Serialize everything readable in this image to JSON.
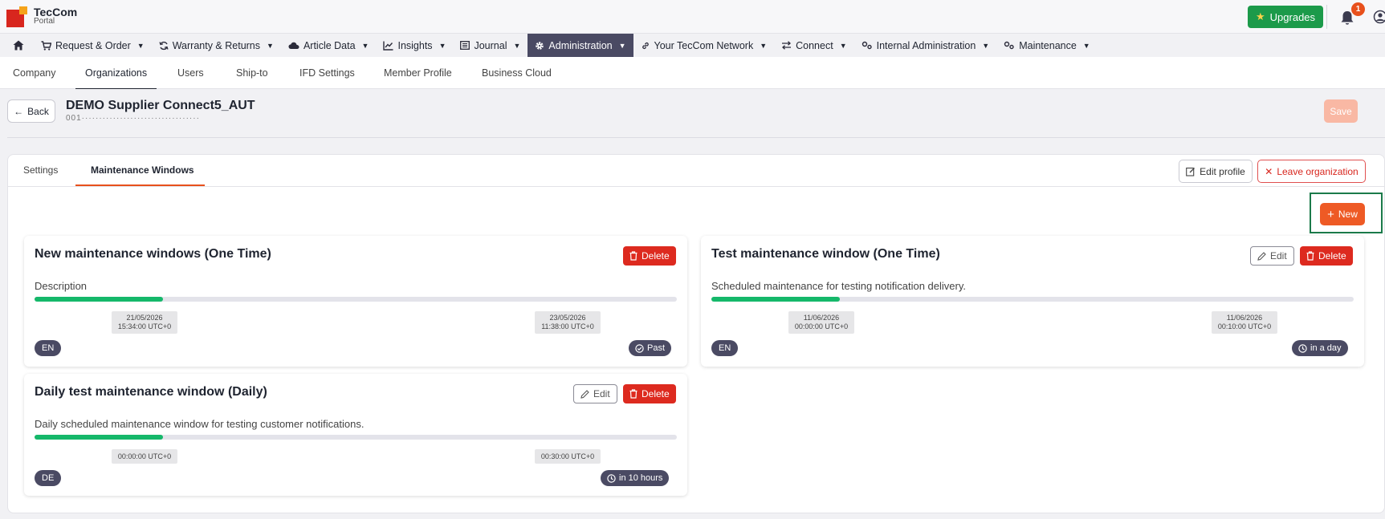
{
  "brand": {
    "name": "TecCom",
    "sub": "Portal"
  },
  "topbar": {
    "upgrades_label": "Upgrades",
    "notification_count": "1"
  },
  "nav": {
    "items": [
      {
        "label": "Request & Order"
      },
      {
        "label": "Warranty & Returns"
      },
      {
        "label": "Article Data"
      },
      {
        "label": "Insights"
      },
      {
        "label": "Journal"
      },
      {
        "label": "Administration"
      },
      {
        "label": "Your TecCom Network"
      },
      {
        "label": "Connect"
      },
      {
        "label": "Internal Administration"
      },
      {
        "label": "Maintenance"
      }
    ]
  },
  "subnav": {
    "tabs": [
      {
        "label": "Company"
      },
      {
        "label": "Organizations"
      },
      {
        "label": "Users"
      },
      {
        "label": "Ship-to"
      },
      {
        "label": "IFD Settings"
      },
      {
        "label": "Member Profile"
      },
      {
        "label": "Business Cloud"
      }
    ]
  },
  "header": {
    "back_label": "Back",
    "title": "DEMO Supplier Connect5_AUT",
    "subtitle": "001··································",
    "save_label": "Save"
  },
  "panel": {
    "tabs": [
      {
        "label": "Settings"
      },
      {
        "label": "Maintenance Windows"
      }
    ],
    "edit_profile_label": "Edit profile",
    "leave_org_label": "Leave organization",
    "new_label": "New"
  },
  "cards": [
    {
      "title": "New maintenance windows (One Time)",
      "description": "Description",
      "start_date": "21/05/2026",
      "start_time": "15:34:00 UTC+0",
      "end_date": "23/05/2026",
      "end_time": "11:38:00 UTC+0",
      "language": "EN",
      "status": "Past",
      "progress": 0.2,
      "delete_label": "Delete"
    },
    {
      "title": "Test maintenance window (One Time)",
      "description": "Scheduled maintenance for testing notification delivery.",
      "start_date": "11/06/2026",
      "start_time": "00:00:00 UTC+0",
      "end_date": "11/06/2026",
      "end_time": "00:10:00 UTC+0",
      "language": "EN",
      "status": "in a day",
      "progress": 0.2,
      "edit_label": "Edit",
      "delete_label": "Delete"
    },
    {
      "title": "Daily test maintenance window (Daily)",
      "description": "Daily scheduled maintenance window for testing customer notifications.",
      "start_time": "00:00:00 UTC+0",
      "end_time": "00:30:00 UTC+0",
      "language": "DE",
      "status": "in 10 hours",
      "progress": 0.2,
      "edit_label": "Edit",
      "delete_label": "Delete"
    }
  ],
  "colors": {
    "accent": "#ee5a25",
    "nav_active": "#4a4a63",
    "delete": "#dd2a1f",
    "progress": "#15b86a",
    "upgrade": "#1c9a4a"
  }
}
